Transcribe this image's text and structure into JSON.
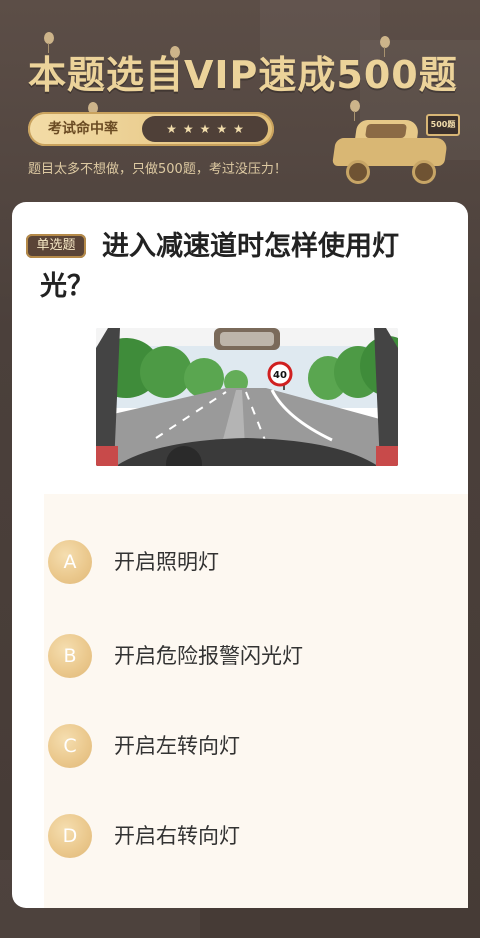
{
  "banner": {
    "title": "本题选自VIP速成500题",
    "rate_label": "考试命中率",
    "rating_stars": 5,
    "rating_glyph": "★",
    "subtitle": "题目太多不想做，只做500题，考过没压力！",
    "car_sign": "500题"
  },
  "question": {
    "type_badge": "单选题",
    "text": "进入减速道时怎样使用灯光？",
    "image": {
      "speed_limit_sign": "40"
    }
  },
  "options": [
    {
      "letter": "A",
      "text": "开启照明灯"
    },
    {
      "letter": "B",
      "text": "开启危险报警闪光灯"
    },
    {
      "letter": "C",
      "text": "开启左转向灯"
    },
    {
      "letter": "D",
      "text": "开启右转向灯"
    }
  ],
  "colors": {
    "background": "#4a3f3a",
    "gold": "#ecd39a",
    "badge_brown": "#5a4437",
    "option_circle": "#ebc98e",
    "options_panel": "#fdf8f1"
  }
}
